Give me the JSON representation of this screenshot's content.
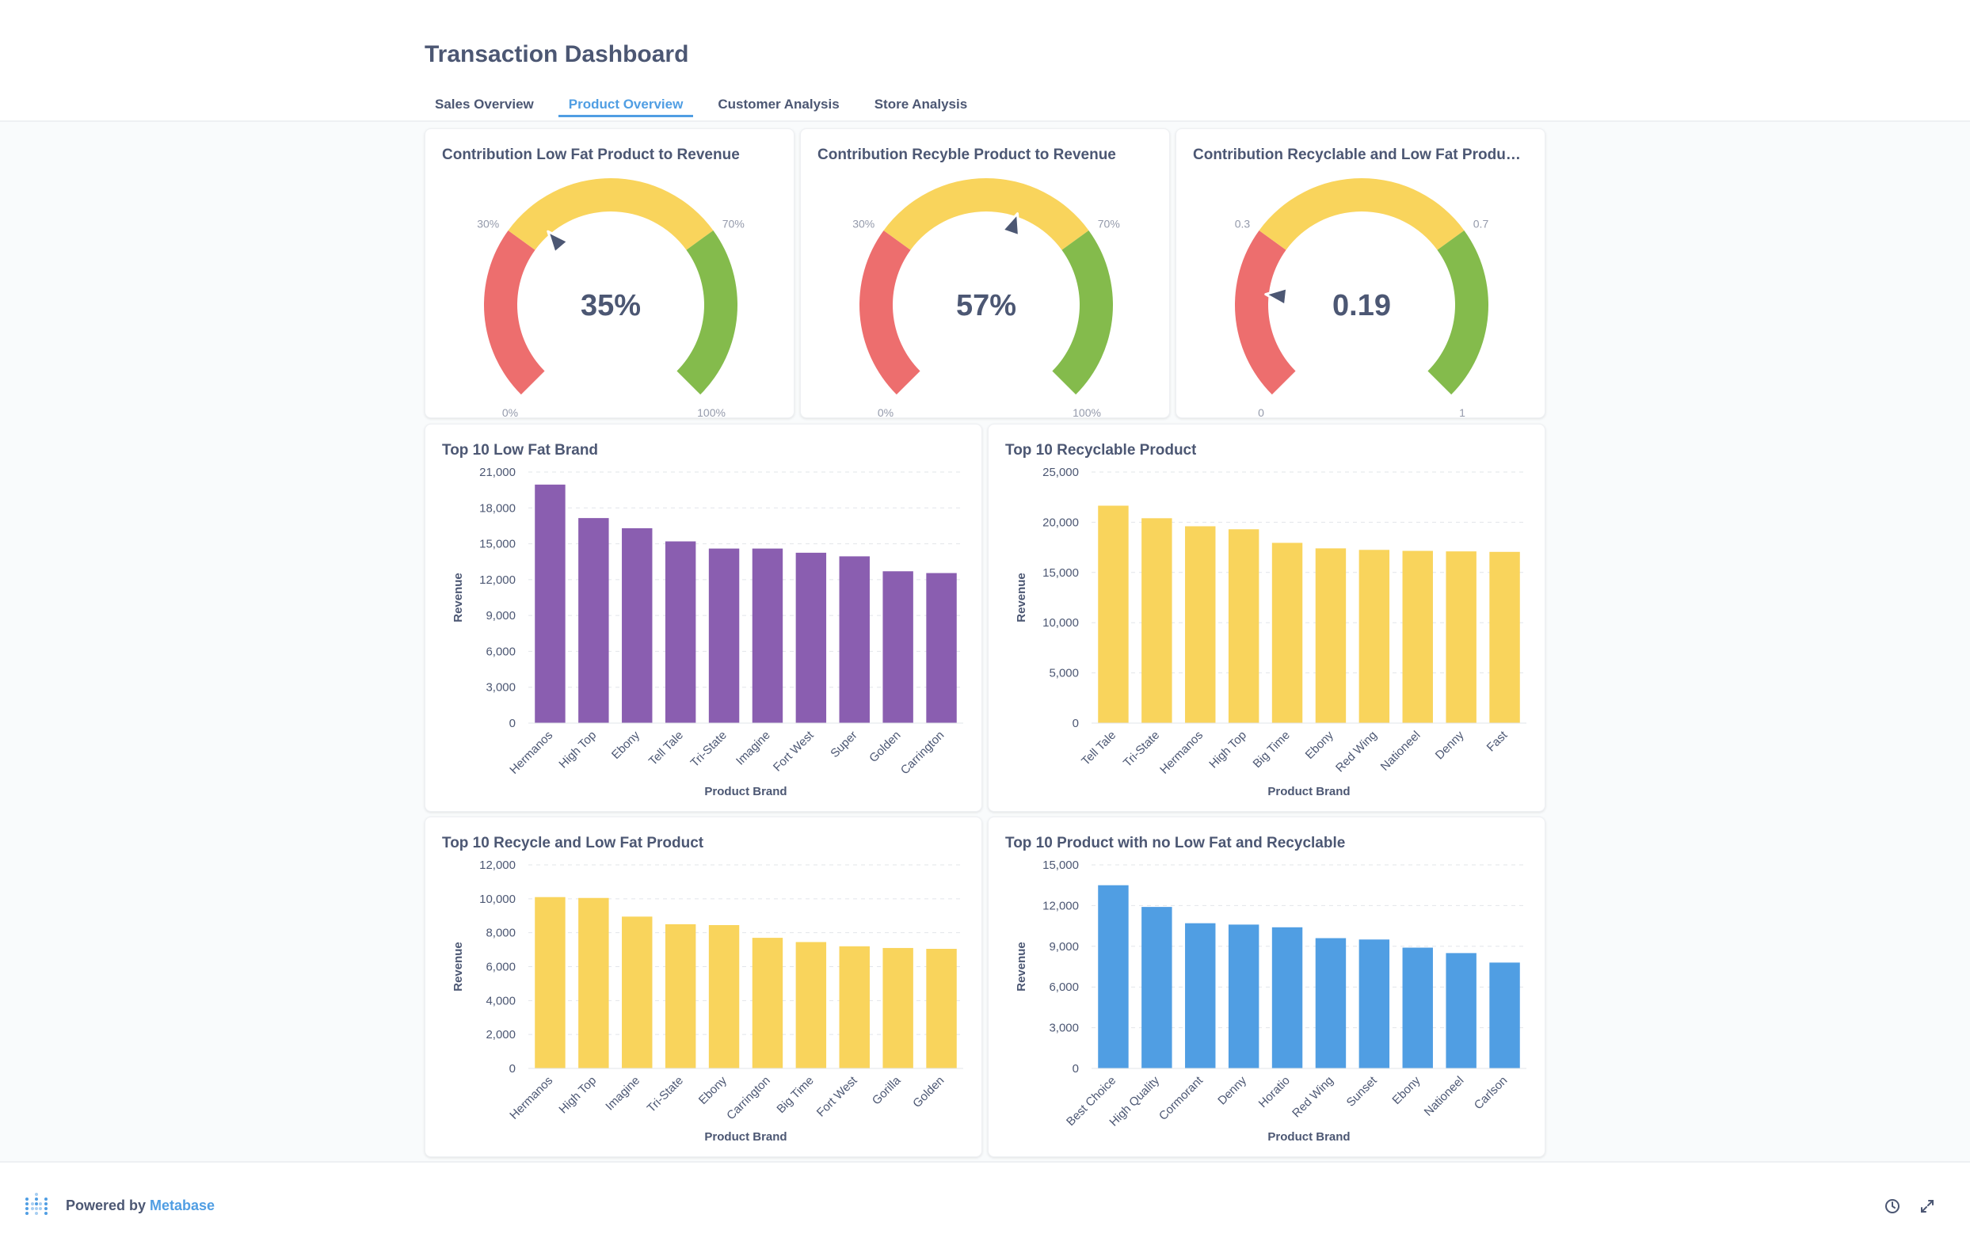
{
  "dashboard": {
    "title": "Transaction Dashboard"
  },
  "tabs": [
    {
      "label": "Sales Overview",
      "active": false
    },
    {
      "label": "Product Overview",
      "active": true
    },
    {
      "label": "Customer Analysis",
      "active": false
    },
    {
      "label": "Store Analysis",
      "active": false
    }
  ],
  "colors": {
    "red": "#ed6e6e",
    "yellow": "#f9d45c",
    "green": "#84bb4c",
    "purple": "#8a5eb0",
    "blue": "#509ee3",
    "text": "#4c5773"
  },
  "gauges": [
    {
      "title": "Contribution Low Fat Product to Revenue",
      "value": 0.35,
      "value_label": "35%",
      "min": 0,
      "max": 1,
      "segment_labels": [
        "0%",
        "30%",
        "70%",
        "100%"
      ]
    },
    {
      "title": "Contribution Recyble Product to Revenue",
      "value": 0.57,
      "value_label": "57%",
      "min": 0,
      "max": 1,
      "segment_labels": [
        "0%",
        "30%",
        "70%",
        "100%"
      ]
    },
    {
      "title": "Contribution Recyclable and Low Fat Product to ...",
      "value": 0.19,
      "value_label": "0.19",
      "min": 0,
      "max": 1,
      "segment_labels": [
        "0",
        "0.3",
        "0.7",
        "1"
      ]
    }
  ],
  "chart_data": [
    {
      "type": "bar",
      "title": "Top 10 Low Fat Brand",
      "xlabel": "Product Brand",
      "ylabel": "Revenue",
      "color": "#8a5eb0",
      "ylim": [
        0,
        21000
      ],
      "yticks": [
        "0",
        "3,000",
        "6,000",
        "9,000",
        "12,000",
        "15,000",
        "18,000",
        "21,000"
      ],
      "categories": [
        "Hermanos",
        "High Top",
        "Ebony",
        "Tell Tale",
        "Tri-State",
        "Imagine",
        "Fort West",
        "Super",
        "Golden",
        "Carrington"
      ],
      "values": [
        19950,
        17150,
        16300,
        15200,
        14600,
        14600,
        14250,
        13950,
        12700,
        12550
      ]
    },
    {
      "type": "bar",
      "title": "Top 10 Recyclable Product",
      "xlabel": "Product Brand",
      "ylabel": "Revenue",
      "color": "#f9d45c",
      "ylim": [
        0,
        25000
      ],
      "yticks": [
        "0",
        "5,000",
        "10,000",
        "15,000",
        "20,000",
        "25,000"
      ],
      "categories": [
        "Tell Tale",
        "Tri-State",
        "Hermanos",
        "High Top",
        "Big Time",
        "Ebony",
        "Red Wing",
        "Nationeel",
        "Denny",
        "Fast"
      ],
      "values": [
        21650,
        20400,
        19600,
        19300,
        17950,
        17400,
        17250,
        17150,
        17100,
        17050
      ]
    },
    {
      "type": "bar",
      "title": "Top 10 Recycle and Low Fat Product",
      "xlabel": "Product Brand",
      "ylabel": "Revenue",
      "color": "#f9d45c",
      "ylim": [
        0,
        12000
      ],
      "yticks": [
        "0",
        "2,000",
        "4,000",
        "6,000",
        "8,000",
        "10,000",
        "12,000"
      ],
      "categories": [
        "Hermanos",
        "High Top",
        "Imagine",
        "Tri-State",
        "Ebony",
        "Carrington",
        "Big Time",
        "Fort West",
        "Gorilla",
        "Golden"
      ],
      "values": [
        10100,
        10050,
        8950,
        8500,
        8450,
        7700,
        7450,
        7200,
        7100,
        7050
      ]
    },
    {
      "type": "bar",
      "title": "Top 10 Product with no Low Fat and Recyclable",
      "xlabel": "Product Brand",
      "ylabel": "Revenue",
      "color": "#509ee3",
      "ylim": [
        0,
        15000
      ],
      "yticks": [
        "0",
        "3,000",
        "6,000",
        "9,000",
        "12,000",
        "15,000"
      ],
      "categories": [
        "Best Choice",
        "High Quality",
        "Cormorant",
        "Denny",
        "Horatio",
        "Red Wing",
        "Sunset",
        "Ebony",
        "Nationeel",
        "Carlson"
      ],
      "values": [
        13500,
        11900,
        10700,
        10600,
        10400,
        9600,
        9500,
        8900,
        8500,
        7800
      ]
    }
  ],
  "footer": {
    "powered_by": "Powered by ",
    "brand": "Metabase"
  }
}
